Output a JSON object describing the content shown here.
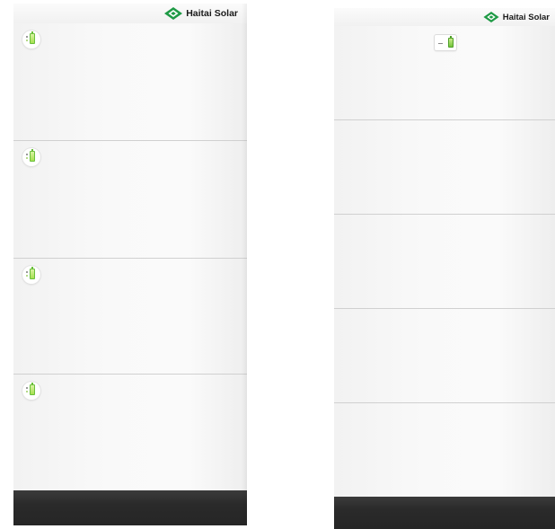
{
  "brand": {
    "name": "Haitai Solar",
    "logo_icon": "green-diamond-logo-icon",
    "logo_color": "#1e9a45"
  },
  "battery_led_color": "#8fd14f",
  "cabinet_body_color": "#f7f7f7",
  "cabinet_base_color": "#2b2b2b",
  "left_cabinet": {
    "battery_module_count": 4,
    "indicator_shape": "round"
  },
  "right_cabinet": {
    "battery_module_count": 5,
    "indicator_shape": "square"
  }
}
